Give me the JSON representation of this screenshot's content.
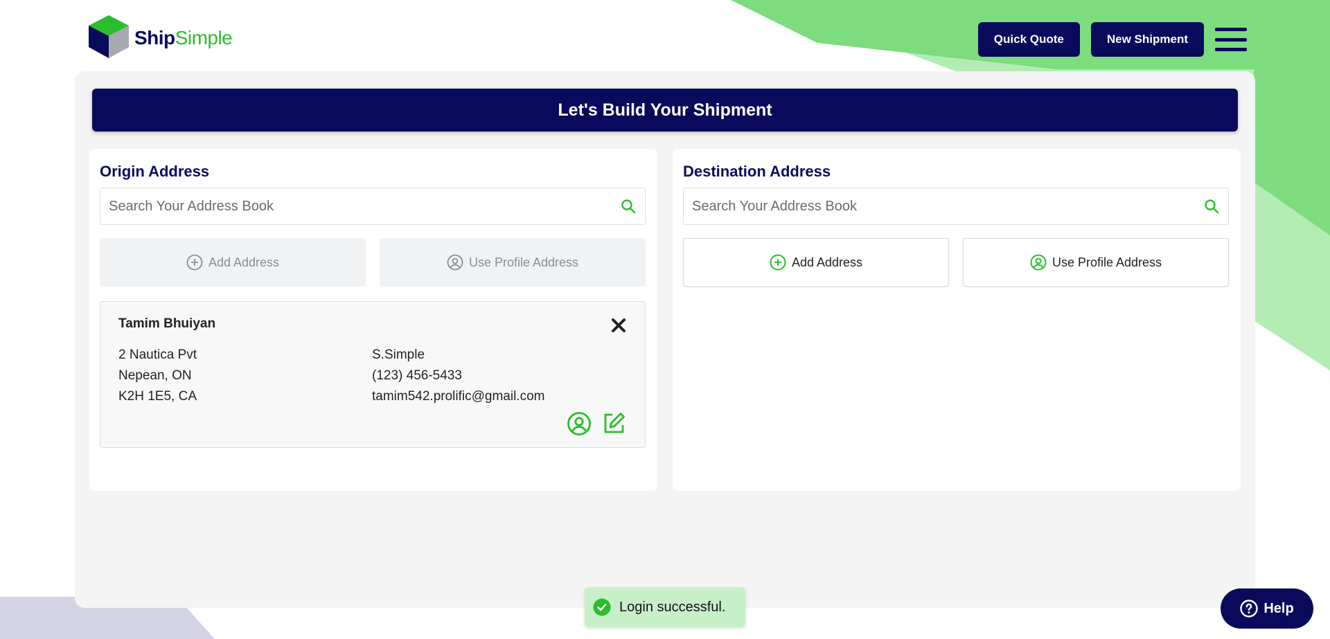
{
  "brand": {
    "name_part1": "Ship",
    "name_part2": "Simple"
  },
  "header": {
    "quick_quote": "Quick Quote",
    "new_shipment": "New Shipment"
  },
  "banner": {
    "title": "Let's Build Your Shipment"
  },
  "origin": {
    "title": "Origin Address",
    "search_placeholder": "Search Your Address Book",
    "add_address": "Add Address",
    "use_profile": "Use Profile Address",
    "address": {
      "name": "Tamim Bhuiyan",
      "street": "2 Nautica Pvt",
      "city": "Nepean, ON",
      "postal": "K2H 1E5, CA",
      "company": "S.Simple",
      "phone": "(123) 456-5433",
      "email": "tamim542.prolific@gmail.com"
    }
  },
  "destination": {
    "title": "Destination Address",
    "search_placeholder": "Search Your Address Book",
    "add_address": "Add Address",
    "use_profile": "Use Profile Address"
  },
  "toast": {
    "message": "Login successful."
  },
  "help": {
    "label": "Help"
  },
  "colors": {
    "navy": "#0a0a5c",
    "green": "#2bbd2b",
    "bg_green": "#7ddc7d",
    "bg_green_light": "#b3ecb3",
    "lavender": "#d3d3e3"
  }
}
